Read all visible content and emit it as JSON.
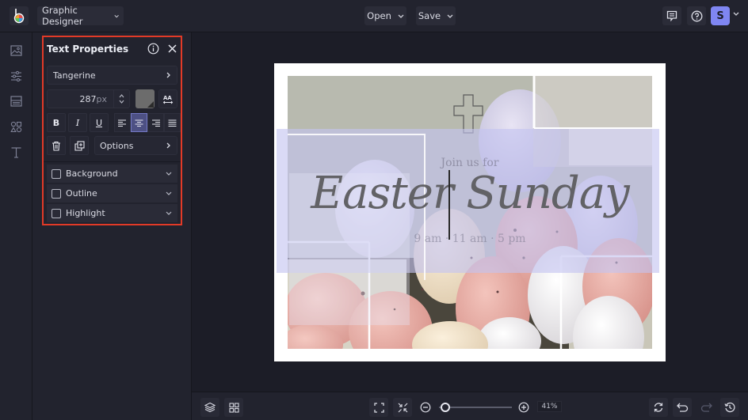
{
  "header": {
    "app_logo": "befunky-logo",
    "project_menu_label": "Graphic Designer",
    "open_label": "Open",
    "save_label": "Save",
    "comments_icon": "comment-icon",
    "help_icon": "help-icon",
    "avatar_initial": "S"
  },
  "left_rail": {
    "items": [
      {
        "icon": "image-icon",
        "label": "Image Manager"
      },
      {
        "icon": "sliders-icon",
        "label": "Customize"
      },
      {
        "icon": "layout-icon",
        "label": "Layouts"
      },
      {
        "icon": "shapes-icon",
        "label": "Graphics"
      },
      {
        "icon": "text-icon",
        "label": "Text"
      }
    ]
  },
  "text_properties": {
    "title": "Text Properties",
    "font_name": "Tangerine",
    "font_size": "287",
    "font_size_unit": "px",
    "text_color": "#6c6c6c",
    "format_buttons": [
      {
        "label": "B",
        "name": "bold"
      },
      {
        "label": "I",
        "name": "italic"
      },
      {
        "label": "U",
        "name": "underline"
      }
    ],
    "alignment": {
      "options": [
        "left",
        "center",
        "right",
        "justify"
      ],
      "selected": "center"
    },
    "options_label": "Options",
    "sections": [
      {
        "label": "Background",
        "checked": false
      },
      {
        "label": "Outline",
        "checked": false
      },
      {
        "label": "Highlight",
        "checked": false
      }
    ]
  },
  "canvas": {
    "intro_text": "Join us for",
    "headline": "Easter Sunday",
    "times_text": "9 am · 11 am · 5 pm"
  },
  "bottom_bar": {
    "zoom_percent": "41%",
    "zoom_level": 0.41
  },
  "colors": {
    "accent": "#7f86f2",
    "selection_border": "#e23a27",
    "active_align": "#4d5083"
  }
}
